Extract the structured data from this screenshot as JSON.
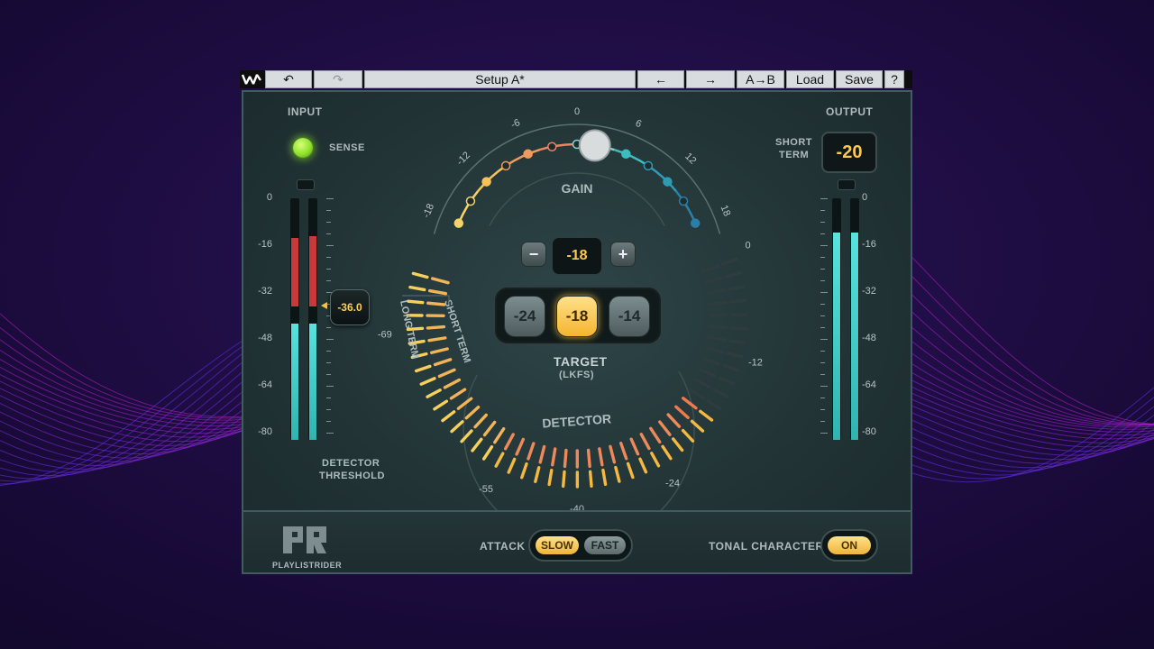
{
  "toolbar": {
    "undo_icon": "undo-icon",
    "redo_icon": "redo-icon",
    "preset_name": "Setup A*",
    "prev_label": "←",
    "next_label": "→",
    "ab_label": "A→B",
    "load_label": "Load",
    "save_label": "Save",
    "help_label": "?"
  },
  "input": {
    "title": "INPUT",
    "sense_label": "SENSE",
    "scale": [
      "0",
      "-16",
      "-32",
      "-48",
      "-64",
      "-80"
    ],
    "threshold_value": "-36.0",
    "threshold_label_1": "DETECTOR",
    "threshold_label_2": "THRESHOLD",
    "meter_left_level": 0.48,
    "meter_right_level": 0.48
  },
  "output": {
    "title": "OUTPUT",
    "short_label_1": "SHORT",
    "short_label_2": "TERM",
    "short_term_value": "-20",
    "scale": [
      "0",
      "-16",
      "-32",
      "-48",
      "-64",
      "-80"
    ],
    "meter_left_level": 0.86,
    "meter_right_level": 0.86
  },
  "gain": {
    "title": "GAIN",
    "ticks": [
      "-18",
      "-12",
      "-6",
      "0",
      "6",
      "12",
      "18"
    ],
    "value": "-18",
    "minus_label": "−",
    "plus_label": "+"
  },
  "target": {
    "options": [
      "-24",
      "-18",
      "-14"
    ],
    "selected": "-18",
    "title": "TARGET",
    "unit": "(LKFS)"
  },
  "detector": {
    "title": "DETECTOR",
    "long_term_label": "LONG TERM",
    "short_term_label": "SHORT TERM",
    "scale": [
      "-69",
      "-55",
      "-40",
      "-24",
      "-12",
      "0"
    ]
  },
  "footer": {
    "brand": "PLAYLISTRIDER",
    "attack_label": "ATTACK",
    "attack_slow": "SLOW",
    "attack_fast": "FAST",
    "tonal_label": "TONAL CHARACTER",
    "tonal_value": "ON"
  },
  "colors": {
    "accent": "#ffc94c",
    "meter": "#4fd8d3",
    "peak": "#c8393a",
    "sense": "#8ee22a"
  }
}
